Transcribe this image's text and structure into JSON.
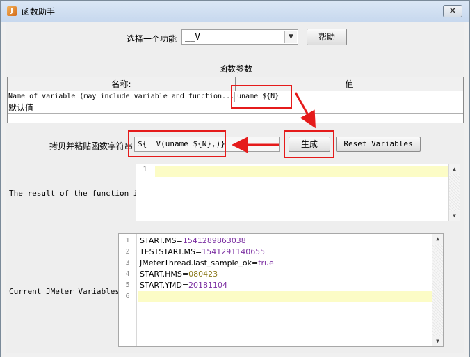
{
  "window": {
    "title": "函数助手",
    "close_symbol": "✕"
  },
  "function_select": {
    "label": "选择一个功能",
    "selected": "__V",
    "help_label": "帮助"
  },
  "params": {
    "heading": "函数参数",
    "col_name": "名称:",
    "col_value": "值",
    "rows": [
      {
        "name": "Name of variable (may include variable and function...",
        "value": "uname_${N}"
      },
      {
        "name": "默认值",
        "value": ""
      }
    ]
  },
  "generate": {
    "copy_label": "拷贝并粘贴函数字符串",
    "function_string": "${__V(uname_${N},)}",
    "generate_label": "生成",
    "reset_label": "Reset Variables"
  },
  "result": {
    "label": "The result of the function is",
    "line_numbers": [
      "1"
    ]
  },
  "variables": {
    "label": "Current JMeter Variables",
    "line_numbers": [
      "1",
      "2",
      "3",
      "4",
      "5",
      "6"
    ],
    "lines": [
      {
        "key": "START.MS",
        "value": "1541289863038"
      },
      {
        "key": "TESTSTART.MS",
        "value": "1541291140655"
      },
      {
        "key": "JMeterThread.last_sample_ok",
        "value": "true"
      },
      {
        "key": "START.HMS",
        "value": "080423"
      },
      {
        "key": "START.YMD",
        "value": "20181104"
      }
    ]
  },
  "colors": {
    "annotation_red": "#e51b1b",
    "value_purple": "#7b2ea1",
    "value_olive": "#8c7a1c",
    "highlight_line": "#fcfcc6"
  }
}
